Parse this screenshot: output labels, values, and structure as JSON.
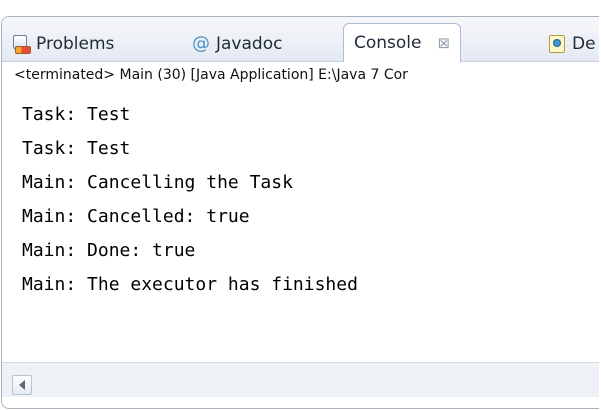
{
  "tabs": [
    {
      "label": "Problems",
      "icon": "problems-icon"
    },
    {
      "label": "Javadoc",
      "icon": "at-icon"
    },
    {
      "label": "Console",
      "icon": "console-icon"
    },
    {
      "label": "De",
      "icon": "declaration-icon"
    }
  ],
  "status": "<terminated> Main (30) [Java Application] E:\\Java 7 Cor",
  "console": {
    "lines": [
      "Task: Test",
      "Task: Test",
      "Main: Cancelling the Task",
      "Main: Cancelled: true",
      "Main: Done: true",
      "Main: The executor has finished"
    ]
  },
  "icons": {
    "close_tab": "⊠",
    "scroll_left": "◀"
  },
  "colors": {
    "border": "#a9b4c2",
    "tabbar_top": "#f7f8fb",
    "tabbar_bottom": "#e4e9f1",
    "console_text": "#000000",
    "status_text": "#111111"
  }
}
